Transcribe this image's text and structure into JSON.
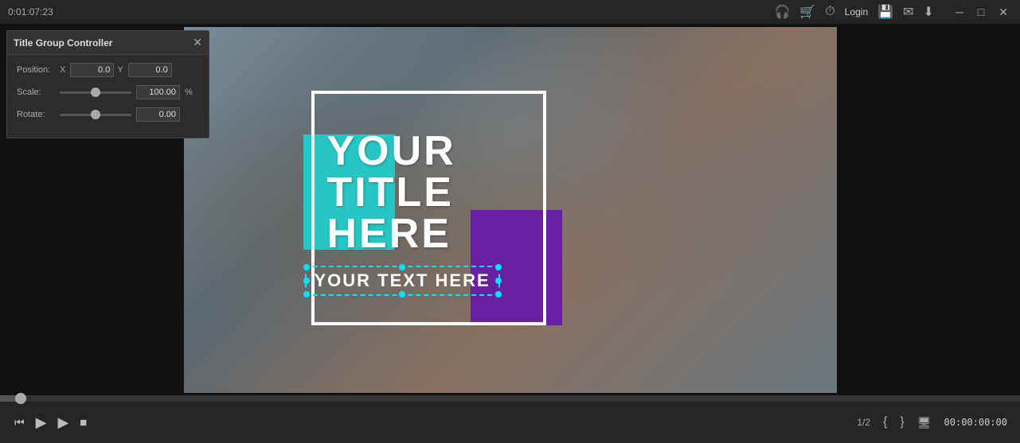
{
  "titlebar": {
    "time": "0:01:07:23",
    "icons": [
      {
        "name": "headset-icon",
        "symbol": "🎧",
        "color": "#4fc3f7"
      },
      {
        "name": "cart-icon",
        "symbol": "🛒",
        "color": "#ef6c00"
      },
      {
        "name": "clock-icon",
        "symbol": "🕐",
        "color": "#aaa"
      },
      {
        "name": "login-label",
        "text": "Login"
      },
      {
        "name": "save-icon",
        "symbol": "💾",
        "color": "#aaa"
      },
      {
        "name": "mail-icon",
        "symbol": "✉",
        "color": "#aaa"
      },
      {
        "name": "download-icon",
        "symbol": "⬇",
        "color": "#aaa"
      }
    ],
    "window_controls": {
      "minimize": "─",
      "maximize": "□",
      "close": "✕"
    }
  },
  "controller": {
    "title": "Title Group Controller",
    "close_symbol": "✕",
    "pin_symbol": "📌",
    "position": {
      "label": "Position:",
      "x_label": "X",
      "x_value": "0.0",
      "y_label": "Y",
      "y_value": "0.0"
    },
    "scale": {
      "label": "Scale:",
      "value": "100.00",
      "unit": "%",
      "slider_value": 30
    },
    "rotate": {
      "label": "Rotate:",
      "value": "0.00",
      "slider_value": 0
    }
  },
  "video": {
    "title_main": "YOUR\nTITLE\nHERE",
    "subtitle": "YOUR TEXT HERE"
  },
  "playback": {
    "progress_percent": 2,
    "controls": {
      "step_back": "⏮",
      "play_pause": "▶",
      "play": "▶",
      "stop": "⏹"
    },
    "page_indicator": "1/2",
    "timecode": "00:00:00:00",
    "bracket_open": "{",
    "bracket_close": "}"
  }
}
